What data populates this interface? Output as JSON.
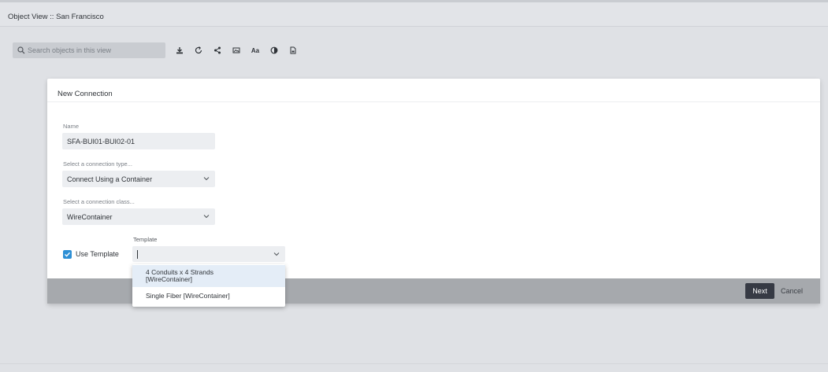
{
  "window": {
    "title": "Object View :: San Francisco"
  },
  "search": {
    "placeholder": "Search objects in this view"
  },
  "toolbar": {
    "icons": [
      "download-icon",
      "refresh-icon",
      "share-icon",
      "image-icon",
      "font-icon",
      "contrast-icon",
      "document-icon"
    ],
    "font_label": "Aa"
  },
  "dialog": {
    "title": "New Connection",
    "name_label": "Name",
    "name_value": "SFA-BUI01-BUI02-01",
    "type_label": "Select a connection type...",
    "type_value": "Connect Using a Container",
    "class_label": "Select a connection class...",
    "class_value": "WireContainer",
    "use_template_label": "Use Template",
    "use_template_checked": true,
    "template_label": "Template",
    "template_value": "",
    "template_options": [
      "4 Conduits x 4 Strands [WireContainer]",
      "Single Fiber [WireContainer]"
    ],
    "next_label": "Next",
    "cancel_label": "Cancel"
  },
  "colors": {
    "accent": "#2d8fd5",
    "primary_button": "#363a44",
    "option_highlight": "#e4edf7"
  }
}
